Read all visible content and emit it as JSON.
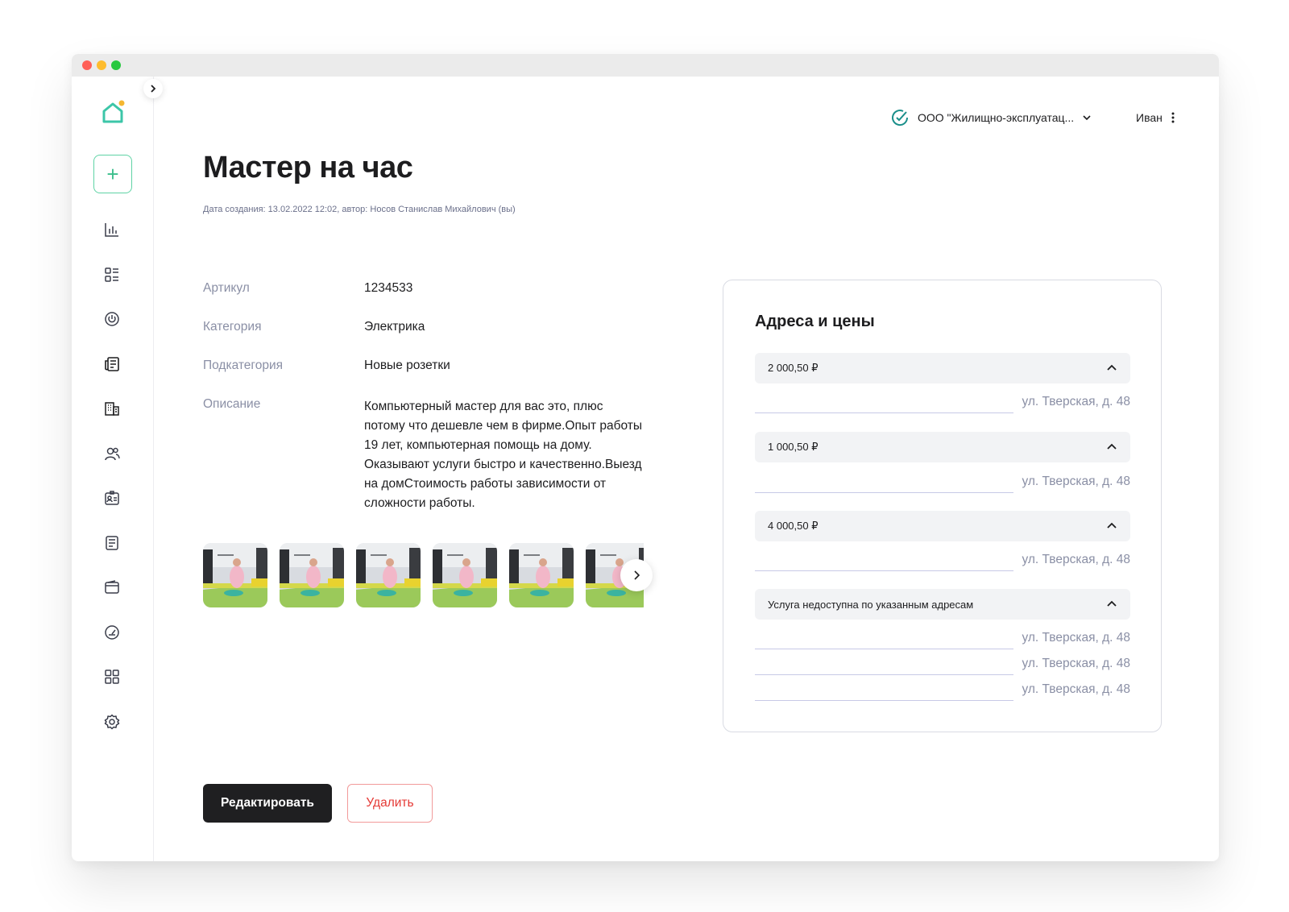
{
  "header": {
    "org_name": "ООО \"Жилищно-эксплуатац...",
    "user_name": "Иван"
  },
  "page": {
    "title": "Мастер на час",
    "meta": "Дата создания: 13.02.2022 12:02, автор: Носов Станислав Михайлович (вы)"
  },
  "details": {
    "article_label": "Артикул",
    "article_value": "1234533",
    "category_label": "Категория",
    "category_value": "Электрика",
    "subcategory_label": "Подкатегория",
    "subcategory_value": "Новые розетки",
    "description_label": "Описание",
    "description_value": "Компьютерный мастер для вас это, плюс потому что дешевле чем в фирме.Опыт работы 19 лет, компьютерная помощь на дому. Оказывают услуги быстро и качественно.Выезд на домСтоимость работы зависимости от сложности работы."
  },
  "prices": {
    "title": "Адреса и цены",
    "groups": [
      {
        "label": "2 000,50 ₽",
        "addresses": [
          "ул. Тверская, д. 48"
        ]
      },
      {
        "label": "1 000,50 ₽",
        "addresses": [
          "ул. Тверская, д. 48"
        ]
      },
      {
        "label": "4 000,50 ₽",
        "addresses": [
          "ул. Тверская, д. 48"
        ]
      },
      {
        "label": "Услуга недоступна по указанным адресам",
        "addresses": [
          "ул. Тверская, д. 48",
          "ул. Тверская, д. 48",
          "ул. Тверская, д. 48"
        ]
      }
    ]
  },
  "actions": {
    "edit_label": "Редактировать",
    "delete_label": "Удалить"
  },
  "icons": {
    "logo": "house-logo-icon",
    "sidebar": [
      "bar-chart-icon",
      "list-icon",
      "power-icon",
      "newspaper-icon",
      "building-icon",
      "users-icon",
      "id-card-icon",
      "document-icon",
      "wallet-icon",
      "gauge-icon",
      "grid-icon",
      "settings-icon"
    ]
  },
  "colors": {
    "accent": "#3cbf8c",
    "primary_button": "#1f1f21",
    "danger": "#e53935"
  }
}
